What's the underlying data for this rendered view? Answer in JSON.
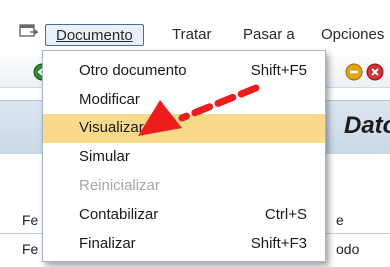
{
  "menubar": {
    "items": [
      {
        "label": "Documento"
      },
      {
        "label": "Tratar"
      },
      {
        "label": "Pasar a"
      },
      {
        "label": "Opciones"
      }
    ]
  },
  "dropdown": {
    "items": [
      {
        "label": "Otro documento",
        "shortcut": "Shift+F5"
      },
      {
        "label": "Modificar",
        "shortcut": ""
      },
      {
        "label": "Visualizar",
        "shortcut": "",
        "highlighted": true
      },
      {
        "label": "Simular",
        "shortcut": ""
      },
      {
        "label": "Reinicializar",
        "shortcut": "",
        "disabled": true
      },
      {
        "label": "Contabilizar",
        "shortcut": "Ctrl+S"
      },
      {
        "label": "Finalizar",
        "shortcut": "Shift+F3"
      }
    ]
  },
  "background": {
    "title": "Dato",
    "row1_left": "Fe",
    "row1_right": "e",
    "row2_left": "Fe",
    "row2_right": "odo"
  },
  "colors": {
    "highlight": "#f9d98a",
    "arrow": "#ee1c1c",
    "active_menu_border": "#4a6d9a"
  },
  "icons": [
    "menu-window-icon",
    "green-back-icon",
    "exit-icon",
    "cancel-icon"
  ]
}
